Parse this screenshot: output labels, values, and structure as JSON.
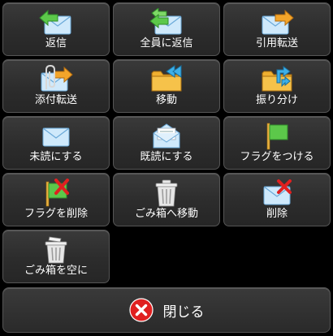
{
  "buttons": {
    "reply": {
      "label": "返信",
      "icon": "reply-mail-icon"
    },
    "reply_all": {
      "label": "全員に返信",
      "icon": "reply-all-mail-icon"
    },
    "forward": {
      "label": "引用転送",
      "icon": "forward-mail-icon"
    },
    "forward_attach": {
      "label": "添付転送",
      "icon": "forward-attachment-icon"
    },
    "move": {
      "label": "移動",
      "icon": "move-folder-icon"
    },
    "sort": {
      "label": "振り分け",
      "icon": "sort-folder-icon"
    },
    "mark_unread": {
      "label": "未読にする",
      "icon": "unread-mail-icon"
    },
    "mark_read": {
      "label": "既読にする",
      "icon": "read-mail-icon"
    },
    "flag": {
      "label": "フラグをつける",
      "icon": "flag-icon"
    },
    "unflag": {
      "label": "フラグを削除",
      "icon": "flag-remove-icon"
    },
    "move_trash": {
      "label": "ごみ箱へ移動",
      "icon": "trash-icon"
    },
    "delete": {
      "label": "削除",
      "icon": "delete-mail-icon"
    },
    "empty_trash": {
      "label": "ごみ箱を空に",
      "icon": "empty-trash-icon"
    }
  },
  "close": {
    "label": "閉じる",
    "icon": "close-icon"
  },
  "colors": {
    "green": "#5cc84a",
    "orange": "#f0a020",
    "red": "#e02020",
    "blue_env": "#bfe4fb"
  }
}
